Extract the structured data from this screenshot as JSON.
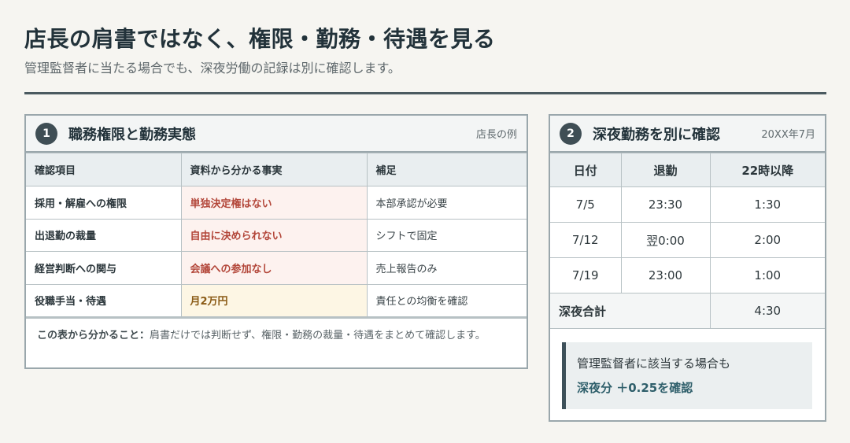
{
  "header": {
    "title": "店長の肩書ではなく、権限・勤務・待遇を見る",
    "subtitle": "管理監督者に当たる場合でも、深夜労働の記録は別に確認します。"
  },
  "left_card": {
    "number": "1",
    "title": "職務権限と勤務実態",
    "note": "店長の例",
    "columns": [
      "確認項目",
      "資料から分かる事実",
      "補足"
    ],
    "rows": [
      {
        "item": "採用・解雇への権限",
        "fact": "単独決定権はない",
        "supplement": "本部承認が必要"
      },
      {
        "item": "出退勤の裁量",
        "fact": "自由に決められない",
        "supplement": "シフトで固定"
      },
      {
        "item": "経営判断への関与",
        "fact": "会議への参加なし",
        "supplement": "売上報告のみ"
      },
      {
        "item": "役職手当・待遇",
        "fact": "月2万円",
        "supplement": "責任との均衡を確認"
      }
    ],
    "conclusion_lead": "この表から分かること：",
    "conclusion_text": "肩書だけでは判断せず、権限・勤務の裁量・待遇をまとめて確認します。"
  },
  "right_card": {
    "number": "2",
    "title": "深夜勤務を別に確認",
    "note": "20XX年7月",
    "columns": [
      "日付",
      "退勤",
      "22時以降"
    ],
    "rows": [
      {
        "date": "7/5",
        "leave": "23:30",
        "night": "1:30"
      },
      {
        "date": "7/12",
        "leave": "翌0:00",
        "night": "2:00"
      },
      {
        "date": "7/19",
        "leave": "23:00",
        "night": "1:00"
      }
    ],
    "total_label": "深夜合計",
    "total_value": "4:30",
    "callout_line1": "管理監督者に該当する場合も",
    "callout_line2": "深夜分 ＋0.25を確認"
  },
  "colors": {
    "badge": "#3f4e55",
    "accent_red": "#b3473a",
    "accent_yellow": "#8a5a15",
    "callout_text": "#2f5f6b"
  }
}
